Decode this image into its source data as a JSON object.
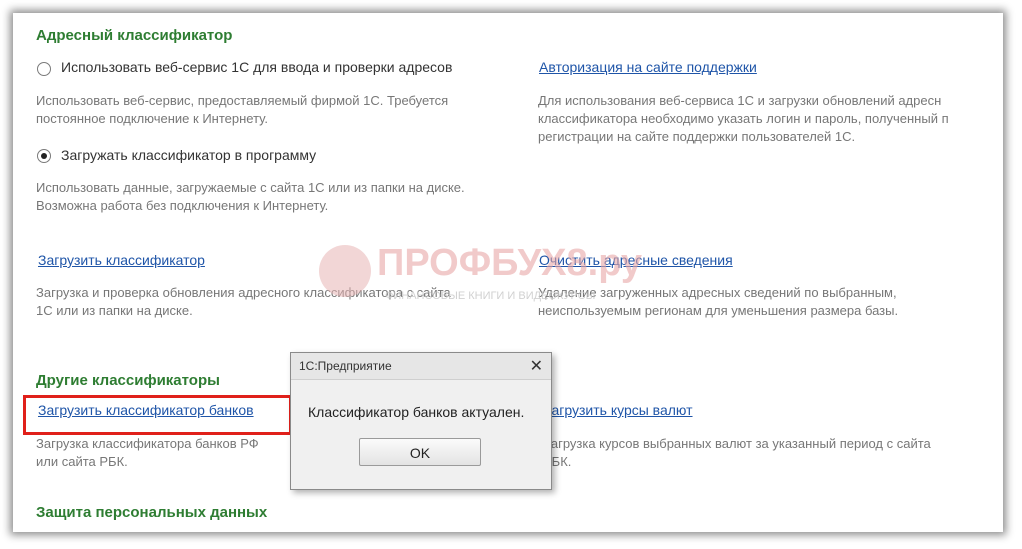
{
  "address": {
    "title": "Адресный классификатор",
    "option_webservice": "Использовать веб-сервис 1С для ввода и проверки адресов",
    "desc_webservice": [
      "Использовать веб-сервис, предоставляемый фирмой 1С. Требуется",
      "постоянное подключение к Интернету."
    ],
    "option_load": "Загружать классификатор в программу",
    "desc_load": [
      "Использовать данные, загружаемые с сайта 1С или из папки на диске.",
      "Возможна работа без подключения к Интернету."
    ],
    "auth_link": "Авторизация на сайте поддержки",
    "auth_desc": [
      "Для использования веб-сервиса 1С и загрузки обновлений адресн",
      "классификатора необходимо указать логин и пароль, полученный п",
      "регистрации на сайте поддержки пользователей 1С."
    ],
    "load_link": "Загрузить классификатор",
    "load_desc": [
      "Загрузка и проверка обновления адресного классификатора с сайта",
      "1С или из папки на диске."
    ],
    "clear_link": "Очистить адресные сведения",
    "clear_desc": [
      "Удаление загруженных адресных сведений по выбранным,",
      "неиспользуемым регионам для уменьшения размера базы."
    ]
  },
  "other": {
    "title": "Другие классификаторы",
    "banks_link": "Загрузить классификатор банков",
    "banks_desc": [
      "Загрузка классификатора банков РФ",
      "или сайта РБК."
    ],
    "currency_link": "Загрузить курсы валют",
    "currency_desc": [
      "Загрузка курсов выбранных валют за указанный период с сайта",
      "РБК."
    ]
  },
  "personal": {
    "title": "Защита персональных данных"
  },
  "dialog": {
    "title": "1С:Предприятие",
    "close": "✕",
    "message": "Классификатор банков актуален.",
    "ok": "OK"
  },
  "watermark": {
    "text": "ПРОФБУХ8.ру",
    "sub": "ФИНАНСОВЫЕ КНИГИ И ВИДЕОКУРСЫ"
  },
  "colors": {
    "section": "#2e7d32",
    "link": "#1f55a8",
    "highlight": "#e0201a"
  }
}
